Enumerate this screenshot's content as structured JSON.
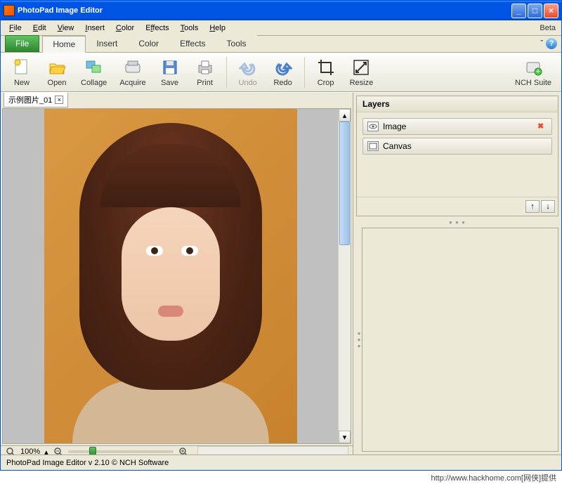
{
  "titlebar": {
    "title": "PhotoPad Image Editor"
  },
  "menubar": {
    "items": [
      "File",
      "Edit",
      "View",
      "Insert",
      "Color",
      "Effects",
      "Tools",
      "Help"
    ],
    "beta": "Beta"
  },
  "ribbon_tabs": {
    "file": "File",
    "tabs": [
      "Home",
      "Insert",
      "Color",
      "Effects",
      "Tools"
    ],
    "active_index": 0,
    "chevron": "ˇ"
  },
  "ribbon": {
    "tools": [
      {
        "label": "New",
        "icon": "new-doc"
      },
      {
        "label": "Open",
        "icon": "folder"
      },
      {
        "label": "Collage",
        "icon": "collage"
      },
      {
        "label": "Acquire",
        "icon": "scanner"
      },
      {
        "label": "Save",
        "icon": "disk"
      },
      {
        "label": "Print",
        "icon": "printer"
      }
    ],
    "group2": [
      {
        "label": "Undo",
        "icon": "undo",
        "disabled": true
      },
      {
        "label": "Redo",
        "icon": "redo"
      }
    ],
    "group3": [
      {
        "label": "Crop",
        "icon": "crop"
      },
      {
        "label": "Resize",
        "icon": "resize"
      }
    ],
    "suite": {
      "label": "NCH Suite",
      "icon": "suite"
    }
  },
  "doc_tab": {
    "name": "示例图片_01"
  },
  "zoom": {
    "pct": "100%"
  },
  "layers": {
    "title": "Layers",
    "items": [
      {
        "name": "Image",
        "icon": "eye",
        "deletable": true
      },
      {
        "name": "Canvas",
        "icon": "canvas",
        "deletable": false
      }
    ]
  },
  "statusbar": {
    "text": "PhotoPad Image Editor v 2.10 © NCH Software"
  },
  "footer": {
    "text": "http://www.hackhome.com[网侠]提供"
  }
}
